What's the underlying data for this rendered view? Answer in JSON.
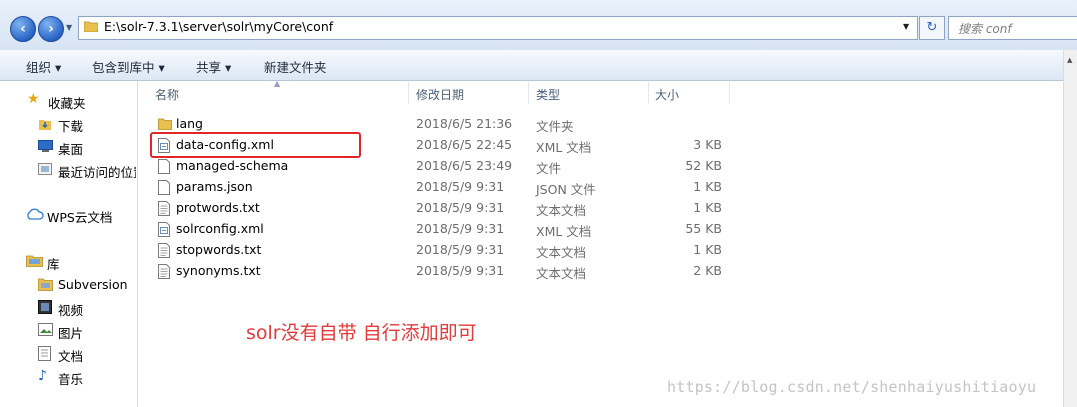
{
  "address": {
    "path": "E:\\solr-7.3.1\\server\\solr\\myCore\\conf",
    "search_placeholder": "搜索 conf"
  },
  "toolbar": {
    "organize": "组织 ▾",
    "include_in_library": "包含到库中 ▾",
    "share": "共享 ▾",
    "new_folder": "新建文件夹"
  },
  "nav": {
    "favorites": "收藏夹",
    "downloads": "下载",
    "desktop": "桌面",
    "recent": "最近访问的位置",
    "wps_cloud": "WPS云文档",
    "libraries": "库",
    "subversion": "Subversion",
    "videos": "视频",
    "pictures": "图片",
    "documents": "文档",
    "music": "音乐"
  },
  "columns": {
    "name": "名称",
    "modified": "修改日期",
    "type": "类型",
    "size": "大小"
  },
  "files": [
    {
      "name": "lang",
      "modified": "2018/6/5 21:36",
      "type": "文件夹",
      "size": "",
      "icon": "folder-icon"
    },
    {
      "name": "data-config.xml",
      "modified": "2018/6/5 22:45",
      "type": "XML 文档",
      "size": "3 KB",
      "icon": "xml-file-icon"
    },
    {
      "name": "managed-schema",
      "modified": "2018/6/5 23:49",
      "type": "文件",
      "size": "52 KB",
      "icon": "file-icon"
    },
    {
      "name": "params.json",
      "modified": "2018/5/9 9:31",
      "type": "JSON 文件",
      "size": "1 KB",
      "icon": "file-icon"
    },
    {
      "name": "protwords.txt",
      "modified": "2018/5/9 9:31",
      "type": "文本文档",
      "size": "1 KB",
      "icon": "text-file-icon"
    },
    {
      "name": "solrconfig.xml",
      "modified": "2018/5/9 9:31",
      "type": "XML 文档",
      "size": "55 KB",
      "icon": "xml-file-icon"
    },
    {
      "name": "stopwords.txt",
      "modified": "2018/5/9 9:31",
      "type": "文本文档",
      "size": "1 KB",
      "icon": "text-file-icon"
    },
    {
      "name": "synonyms.txt",
      "modified": "2018/5/9 9:31",
      "type": "文本文档",
      "size": "2 KB",
      "icon": "text-file-icon"
    }
  ],
  "annotation": "solr没有自带 自行添加即可",
  "watermark": "https://blog.csdn.net/shenhaiyushitiaoyu",
  "colors": {
    "highlight": "#e0262b",
    "annotation": "#e23b3b"
  }
}
